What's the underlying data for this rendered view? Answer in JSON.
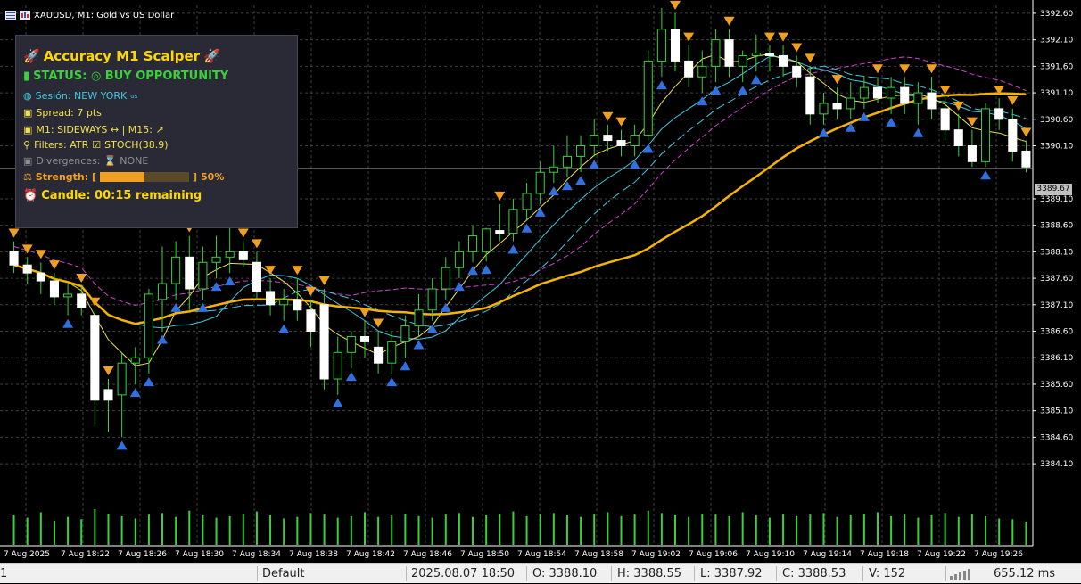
{
  "window": {
    "title": "XAUUSD, M1:  Gold vs US Dollar"
  },
  "panel": {
    "title": "Accuracy M1 Scalper",
    "status": "STATUS: ◎ BUY OPPORTUNITY",
    "session": "Sesión: NEW YORK",
    "session_flag": "us",
    "spread": "Spread: 7 pts",
    "trend": "M1: SIDEWAYS ↔ | M15: ↗",
    "filters": "Filters: ATR",
    "filters_extra": "STOCH(38.9)",
    "divergences": "Divergences: ",
    "divergences_value": "NONE",
    "strength_label": "Strength: [",
    "strength_end": "]",
    "strength_pct": "50%",
    "strength_value": 0.5,
    "candle": "Candle: 00:15 remaining"
  },
  "price_axis": {
    "labels": [
      "3392.60",
      "3392.10",
      "3391.60",
      "3391.10",
      "3390.60",
      "3390.10",
      "3389.10",
      "3388.60",
      "3388.10",
      "3387.60",
      "3387.10",
      "3386.60",
      "3386.10",
      "3385.60",
      "3385.10",
      "3384.60",
      "3384.10"
    ],
    "current_price": "3389.67"
  },
  "time_axis": {
    "labels": [
      "7 Aug 2025",
      "7 Aug 18:22",
      "7 Aug 18:26",
      "7 Aug 18:30",
      "7 Aug 18:34",
      "7 Aug 18:38",
      "7 Aug 18:42",
      "7 Aug 18:46",
      "7 Aug 18:50",
      "7 Aug 18:54",
      "7 Aug 18:58",
      "7 Aug 19:02",
      "7 Aug 19:06",
      "7 Aug 19:10",
      "7 Aug 19:14",
      "7 Aug 19:18",
      "7 Aug 19:22",
      "7 Aug 19:26"
    ]
  },
  "status_bar": {
    "left_text": "1",
    "profile": "Default",
    "datetime": "2025.08.07 18:50",
    "open": "O: 3388.10",
    "high": "H: 3388.55",
    "low": "L: 3387.92",
    "close": "C: 3388.53",
    "volume": "V: 152",
    "latency": "655.12 ms"
  },
  "colors": {
    "bull": "#ffffff",
    "bear": "#ffffff",
    "wick": "#3ad13a",
    "ma_slow": "#f5b400",
    "ma_fast": "#f0e050",
    "ma_cyan": "#40c8e0",
    "ma_magenta": "#d040d0",
    "sell_arrow": "#f0a020",
    "buy_arrow": "#3070e0",
    "volume": "#3ad13a",
    "grid": "#404040"
  },
  "chart_data": {
    "type": "candlestick",
    "symbol": "XAUUSD",
    "timeframe": "M1",
    "ylim": [
      3383.9,
      3392.75
    ],
    "candles": [
      {
        "o": 3388.1,
        "h": 3388.3,
        "l": 3387.7,
        "c": 3387.85
      },
      {
        "o": 3387.85,
        "h": 3388.0,
        "l": 3387.5,
        "c": 3387.7
      },
      {
        "o": 3387.7,
        "h": 3387.9,
        "l": 3387.3,
        "c": 3387.55
      },
      {
        "o": 3387.55,
        "h": 3387.7,
        "l": 3387.1,
        "c": 3387.25
      },
      {
        "o": 3387.25,
        "h": 3387.5,
        "l": 3386.9,
        "c": 3387.3
      },
      {
        "o": 3387.3,
        "h": 3387.45,
        "l": 3386.9,
        "c": 3387.05
      },
      {
        "o": 3386.9,
        "h": 3387.0,
        "l": 3384.8,
        "c": 3385.3
      },
      {
        "o": 3385.5,
        "h": 3385.7,
        "l": 3384.7,
        "c": 3385.3
      },
      {
        "o": 3385.4,
        "h": 3386.2,
        "l": 3384.6,
        "c": 3386.0
      },
      {
        "o": 3386.0,
        "h": 3386.3,
        "l": 3385.6,
        "c": 3386.1
      },
      {
        "o": 3386.1,
        "h": 3387.4,
        "l": 3385.8,
        "c": 3387.3
      },
      {
        "o": 3387.2,
        "h": 3388.2,
        "l": 3386.6,
        "c": 3387.5
      },
      {
        "o": 3387.5,
        "h": 3388.3,
        "l": 3387.2,
        "c": 3388.0
      },
      {
        "o": 3388.0,
        "h": 3388.4,
        "l": 3387.0,
        "c": 3387.4
      },
      {
        "o": 3387.4,
        "h": 3388.2,
        "l": 3387.2,
        "c": 3387.9
      },
      {
        "o": 3387.9,
        "h": 3388.4,
        "l": 3387.6,
        "c": 3388.0
      },
      {
        "o": 3388.0,
        "h": 3388.6,
        "l": 3387.7,
        "c": 3388.1
      },
      {
        "o": 3388.1,
        "h": 3388.3,
        "l": 3387.8,
        "c": 3387.95
      },
      {
        "o": 3387.9,
        "h": 3388.1,
        "l": 3387.2,
        "c": 3387.35
      },
      {
        "o": 3387.35,
        "h": 3387.6,
        "l": 3386.9,
        "c": 3387.1
      },
      {
        "o": 3387.1,
        "h": 3387.4,
        "l": 3386.8,
        "c": 3387.2
      },
      {
        "o": 3387.2,
        "h": 3387.6,
        "l": 3386.8,
        "c": 3387.0
      },
      {
        "o": 3387.0,
        "h": 3387.2,
        "l": 3386.3,
        "c": 3386.6
      },
      {
        "o": 3387.1,
        "h": 3387.4,
        "l": 3385.5,
        "c": 3385.7
      },
      {
        "o": 3385.7,
        "h": 3386.5,
        "l": 3385.4,
        "c": 3386.2
      },
      {
        "o": 3386.2,
        "h": 3386.6,
        "l": 3385.9,
        "c": 3386.5
      },
      {
        "o": 3386.5,
        "h": 3386.8,
        "l": 3386.1,
        "c": 3386.4
      },
      {
        "o": 3386.3,
        "h": 3386.6,
        "l": 3385.8,
        "c": 3386.0
      },
      {
        "o": 3386.0,
        "h": 3386.6,
        "l": 3385.8,
        "c": 3386.4
      },
      {
        "o": 3386.4,
        "h": 3386.9,
        "l": 3386.1,
        "c": 3386.7
      },
      {
        "o": 3386.7,
        "h": 3387.3,
        "l": 3386.5,
        "c": 3387.0
      },
      {
        "o": 3387.0,
        "h": 3387.6,
        "l": 3386.8,
        "c": 3387.4
      },
      {
        "o": 3387.4,
        "h": 3388.0,
        "l": 3387.2,
        "c": 3387.8
      },
      {
        "o": 3387.8,
        "h": 3388.3,
        "l": 3387.6,
        "c": 3388.1
      },
      {
        "o": 3388.1,
        "h": 3388.6,
        "l": 3387.9,
        "c": 3388.4
      },
      {
        "o": 3388.1,
        "h": 3388.55,
        "l": 3387.92,
        "c": 3388.53
      },
      {
        "o": 3388.5,
        "h": 3389.0,
        "l": 3388.3,
        "c": 3388.45
      },
      {
        "o": 3388.45,
        "h": 3389.1,
        "l": 3388.3,
        "c": 3388.9
      },
      {
        "o": 3388.9,
        "h": 3389.4,
        "l": 3388.7,
        "c": 3389.2
      },
      {
        "o": 3389.2,
        "h": 3389.8,
        "l": 3389.0,
        "c": 3389.6
      },
      {
        "o": 3389.6,
        "h": 3390.1,
        "l": 3389.4,
        "c": 3389.7
      },
      {
        "o": 3389.7,
        "h": 3390.3,
        "l": 3389.5,
        "c": 3389.9
      },
      {
        "o": 3389.9,
        "h": 3390.3,
        "l": 3389.6,
        "c": 3390.1
      },
      {
        "o": 3390.1,
        "h": 3390.6,
        "l": 3389.9,
        "c": 3390.3
      },
      {
        "o": 3390.3,
        "h": 3390.5,
        "l": 3390.0,
        "c": 3390.2
      },
      {
        "o": 3390.2,
        "h": 3390.4,
        "l": 3389.9,
        "c": 3390.1
      },
      {
        "o": 3390.1,
        "h": 3390.5,
        "l": 3389.9,
        "c": 3390.3
      },
      {
        "o": 3390.3,
        "h": 3391.9,
        "l": 3390.2,
        "c": 3391.7
      },
      {
        "o": 3391.7,
        "h": 3392.7,
        "l": 3391.4,
        "c": 3392.3
      },
      {
        "o": 3392.3,
        "h": 3392.6,
        "l": 3391.5,
        "c": 3391.7
      },
      {
        "o": 3391.7,
        "h": 3392.0,
        "l": 3391.2,
        "c": 3391.4
      },
      {
        "o": 3391.4,
        "h": 3391.9,
        "l": 3391.1,
        "c": 3391.6
      },
      {
        "o": 3391.6,
        "h": 3392.3,
        "l": 3391.3,
        "c": 3392.1
      },
      {
        "o": 3392.1,
        "h": 3392.3,
        "l": 3391.4,
        "c": 3391.6
      },
      {
        "o": 3391.6,
        "h": 3391.9,
        "l": 3391.3,
        "c": 3391.8
      },
      {
        "o": 3391.8,
        "h": 3392.2,
        "l": 3391.5,
        "c": 3391.85
      },
      {
        "o": 3391.85,
        "h": 3392.0,
        "l": 3391.5,
        "c": 3391.8
      },
      {
        "o": 3391.8,
        "h": 3392.0,
        "l": 3391.4,
        "c": 3391.6
      },
      {
        "o": 3391.6,
        "h": 3391.8,
        "l": 3391.2,
        "c": 3391.4
      },
      {
        "o": 3391.4,
        "h": 3391.6,
        "l": 3390.5,
        "c": 3390.7
      },
      {
        "o": 3390.7,
        "h": 3391.1,
        "l": 3390.5,
        "c": 3390.9
      },
      {
        "o": 3390.9,
        "h": 3391.2,
        "l": 3390.6,
        "c": 3390.8
      },
      {
        "o": 3390.8,
        "h": 3391.3,
        "l": 3390.6,
        "c": 3391.0
      },
      {
        "o": 3391.0,
        "h": 3391.4,
        "l": 3390.8,
        "c": 3391.2
      },
      {
        "o": 3391.2,
        "h": 3391.4,
        "l": 3390.9,
        "c": 3391.0
      },
      {
        "o": 3391.0,
        "h": 3391.4,
        "l": 3390.7,
        "c": 3391.2
      },
      {
        "o": 3391.2,
        "h": 3391.4,
        "l": 3390.7,
        "c": 3390.9
      },
      {
        "o": 3390.9,
        "h": 3391.3,
        "l": 3390.5,
        "c": 3391.1
      },
      {
        "o": 3391.1,
        "h": 3391.4,
        "l": 3390.6,
        "c": 3390.8
      },
      {
        "o": 3390.8,
        "h": 3391.0,
        "l": 3390.2,
        "c": 3390.4
      },
      {
        "o": 3390.4,
        "h": 3390.7,
        "l": 3389.9,
        "c": 3390.1
      },
      {
        "o": 3390.1,
        "h": 3390.4,
        "l": 3389.7,
        "c": 3389.8
      },
      {
        "o": 3389.8,
        "h": 3390.9,
        "l": 3389.7,
        "c": 3390.8
      },
      {
        "o": 3390.8,
        "h": 3391.0,
        "l": 3390.4,
        "c": 3390.6
      },
      {
        "o": 3390.6,
        "h": 3390.8,
        "l": 3389.8,
        "c": 3390.0
      },
      {
        "o": 3390.0,
        "h": 3390.2,
        "l": 3389.6,
        "c": 3389.7
      }
    ],
    "volumes": [
      38,
      35,
      42,
      31,
      36,
      33,
      46,
      40,
      37,
      34,
      39,
      41,
      36,
      44,
      38,
      35,
      37,
      40,
      43,
      38,
      34,
      36,
      41,
      39,
      35,
      37,
      42,
      36,
      38,
      40,
      37,
      35,
      39,
      41,
      36,
      38,
      40,
      43,
      37,
      39,
      41,
      38,
      36,
      40,
      42,
      37,
      39,
      44,
      41,
      38,
      36,
      40,
      39,
      37,
      42,
      38,
      35,
      40,
      37,
      39,
      41,
      36,
      38,
      40,
      42,
      37,
      39,
      35,
      38,
      41,
      36,
      40,
      37,
      34,
      33,
      30
    ]
  }
}
